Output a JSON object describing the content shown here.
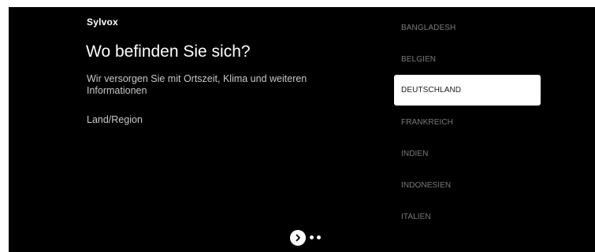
{
  "brand": "Sylvox",
  "title": "Wo befinden Sie sich?",
  "subtitle": "Wir versorgen Sie mit Ortszeit, Klima und weiteren Informationen",
  "region_label": "Land/Region",
  "countries": [
    {
      "label": "BANGLADESH",
      "selected": false
    },
    {
      "label": "BELGIEN",
      "selected": false
    },
    {
      "label": "DEUTSCHLAND",
      "selected": true
    },
    {
      "label": "FRANKREICH",
      "selected": false
    },
    {
      "label": "INDIEN",
      "selected": false
    },
    {
      "label": "INDONESIEN",
      "selected": false
    },
    {
      "label": "ITALIEN",
      "selected": false
    }
  ],
  "pager": {
    "next_icon": "chevron-right-icon",
    "dots": 2
  },
  "colors": {
    "background": "#000000",
    "text": "#ffffff",
    "muted_text": "#c8c8c8",
    "list_text": "#7a7a7a",
    "selected_bg": "#ffffff",
    "selected_text": "#1a1a1a"
  }
}
